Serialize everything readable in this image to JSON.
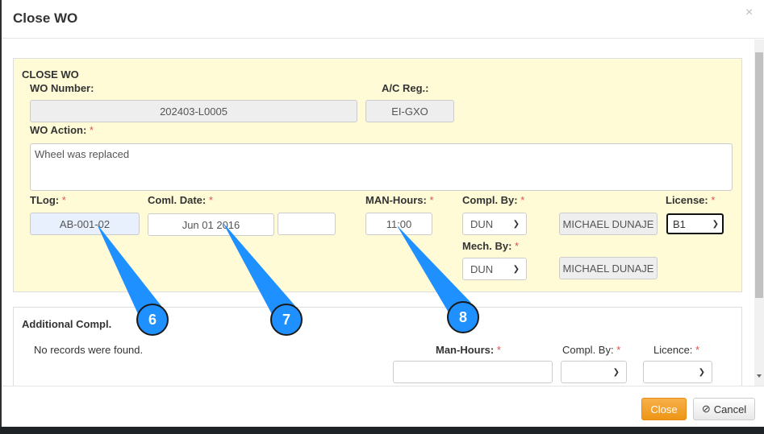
{
  "modal": {
    "title": "Close WO",
    "close_glyph": "×"
  },
  "close_wo": {
    "section_title": "CLOSE WO",
    "wo_number_label": "WO Number:",
    "wo_number": "202403-L0005",
    "ac_reg_label": "A/C Reg.:",
    "ac_reg": "EI-GXO",
    "wo_action_label": "WO Action:",
    "wo_action": "Wheel was replaced",
    "tlog_label": "TLog:",
    "tlog": "AB-001-02",
    "coml_date_label": "Coml. Date:",
    "coml_date": "Jun 01 2016",
    "coml_time": "",
    "man_hours_label": "MAN-Hours:",
    "man_hours": "11:00",
    "compl_by_label": "Compl. By:",
    "compl_by": "DUN",
    "compl_by_name": "MICHAEL DUNAJE",
    "license_label": "License:",
    "license": "B1",
    "mech_by_label": "Mech. By:",
    "mech_by": "DUN",
    "mech_by_name": "MICHAEL DUNAJE",
    "required_mark": "*"
  },
  "additional": {
    "section_title": "Additional Compl.",
    "empty_text": "No records were found.",
    "man_hours_label": "Man-Hours:",
    "compl_by_label": "Compl. By:",
    "licence_label": "Licence:"
  },
  "footer": {
    "close_label": "Close",
    "cancel_label": "Cancel"
  },
  "callouts": [
    "6",
    "7",
    "8"
  ],
  "colors": {
    "panel_bg": "#fffbd6",
    "callout": "#1e90ff",
    "close_button": "#f0a030"
  }
}
